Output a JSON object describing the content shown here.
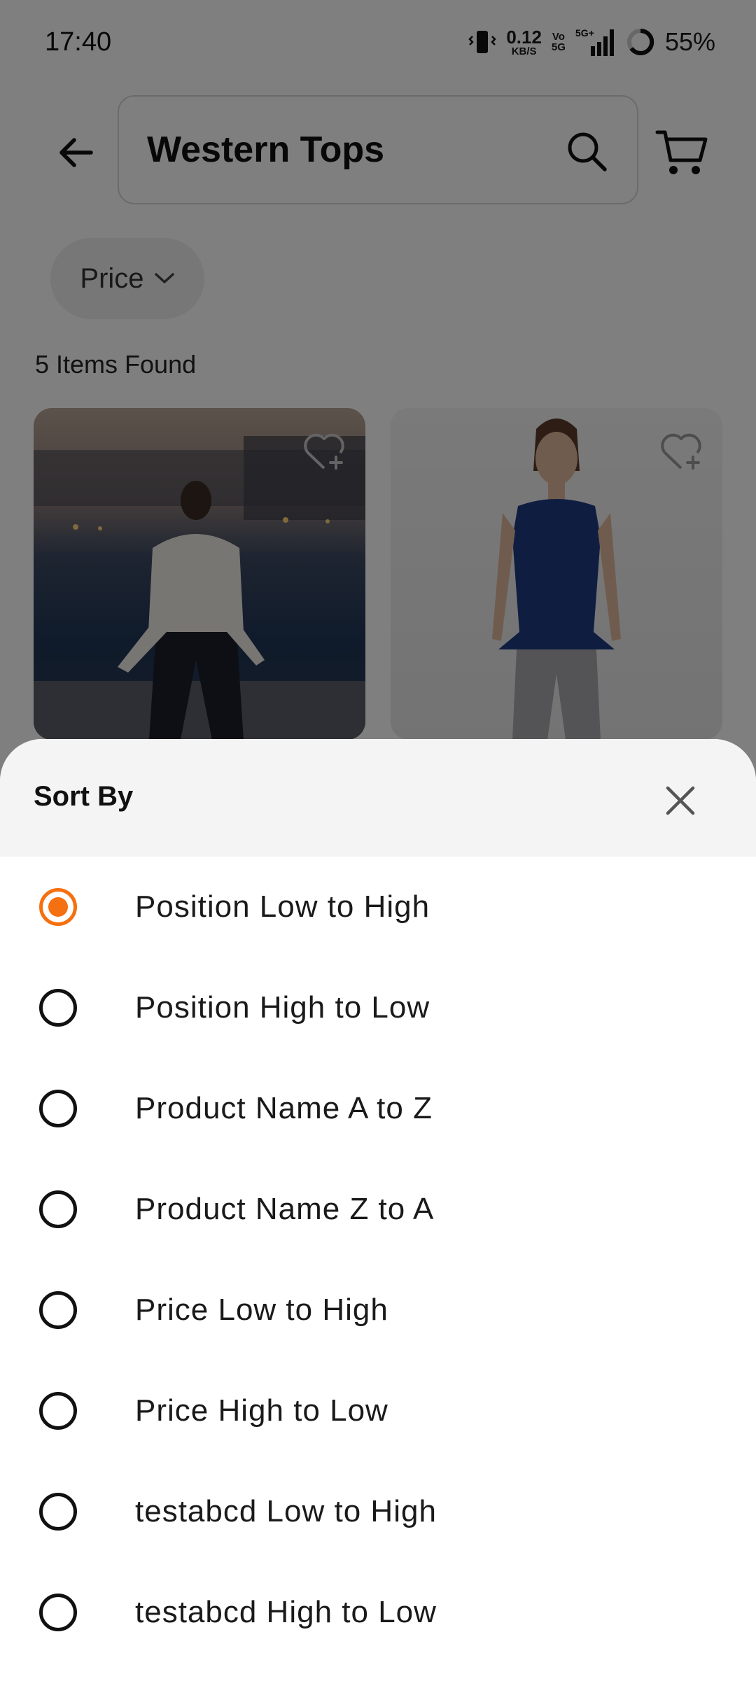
{
  "status_bar": {
    "time": "17:40",
    "net_speed_value": "0.12",
    "net_speed_unit": "KB/S",
    "vo_top": "Vo",
    "vo_bottom": "5G",
    "network_type": "5G+",
    "battery_percent": "55%"
  },
  "header": {
    "search_query": "Western Tops"
  },
  "filters": {
    "price_chip_label": "Price"
  },
  "results": {
    "count_text": "5 Items Found"
  },
  "sort_sheet": {
    "title": "Sort By",
    "selected_index": 0,
    "accent_color": "#f57010",
    "options": [
      {
        "label": "Position Low to High"
      },
      {
        "label": "Position High to Low"
      },
      {
        "label": "Product Name A to Z"
      },
      {
        "label": "Product Name Z to A"
      },
      {
        "label": "Price Low to High"
      },
      {
        "label": "Price High to Low"
      },
      {
        "label": "testabcd Low to High"
      },
      {
        "label": "testabcd High to Low"
      }
    ]
  },
  "icons": {
    "back": "arrow-left-icon",
    "search": "search-icon",
    "cart": "cart-icon",
    "chip": "chevron-down-icon",
    "wishlist": "heart-plus-icon",
    "close": "close-icon"
  }
}
